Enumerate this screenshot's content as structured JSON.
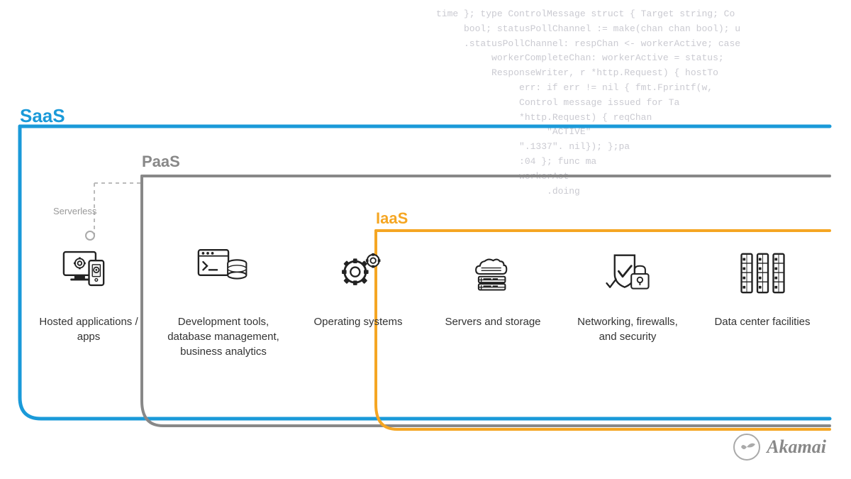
{
  "background_code": "time }; type ControlMessage struct { Target string; Co\n     bool; statusPollChannel := make(chan chan bool); u\n     .statusPollChannel: respChan <- workerActive; case\n          workerCompleteChan: workerActive = status;\n          ResponseWriter, r *http.Request) { hostTo\n               err: if err != nil { fmt.Fprintf(w,\n               Control message issued for Ta\n               *http.Request) { reqChan\n                    \"ACTIVE\"\n               \".1337\". nil}); };pa\n               :04 }; func ma\n               workerAct\n                    .doing",
  "labels": {
    "saas": "SaaS",
    "paas": "PaaS",
    "iaas": "IaaS",
    "serverless": "Serverless"
  },
  "colors": {
    "saas": "#1a9ad9",
    "paas": "#888888",
    "iaas": "#f5a623",
    "serverless_line": "#bbbbbb"
  },
  "services": [
    {
      "id": "hosted-apps",
      "label": "Hosted applications / apps",
      "icon": "hosted-apps-icon"
    },
    {
      "id": "dev-tools",
      "label": "Development tools, database management, business analytics",
      "icon": "dev-tools-icon"
    },
    {
      "id": "operating-systems",
      "label": "Operating systems",
      "icon": "os-icon"
    },
    {
      "id": "servers-storage",
      "label": "Servers and storage",
      "icon": "server-icon"
    },
    {
      "id": "networking",
      "label": "Networking, firewalls, and security",
      "icon": "networking-icon"
    },
    {
      "id": "data-center",
      "label": "Data center facilities",
      "icon": "datacenter-icon"
    }
  ],
  "akamai": {
    "text": "Akamai"
  }
}
